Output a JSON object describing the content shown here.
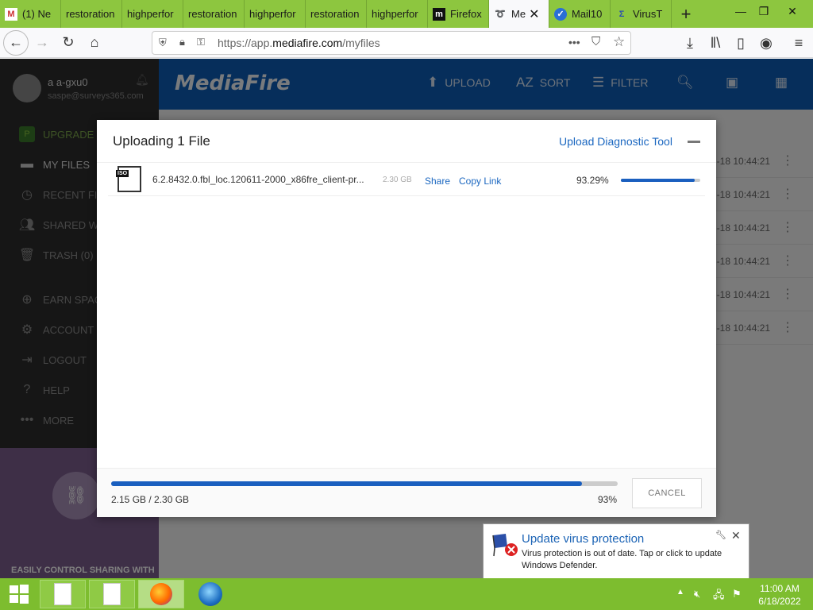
{
  "browser": {
    "tabs": [
      {
        "label": "(1) Ne",
        "icon": "mail-icon"
      },
      {
        "label": "restoration",
        "icon": ""
      },
      {
        "label": "highperfor",
        "icon": ""
      },
      {
        "label": "restoration",
        "icon": ""
      },
      {
        "label": "highperfor",
        "icon": ""
      },
      {
        "label": "restoration",
        "icon": ""
      },
      {
        "label": "highperfor",
        "icon": ""
      },
      {
        "label": "Firefox",
        "icon": "m-logo-icon"
      },
      {
        "label": "Me",
        "icon": "mediafire-icon",
        "active": true
      },
      {
        "label": "Mail10",
        "icon": "mail-icon"
      },
      {
        "label": "VirusT",
        "icon": "virustotal-icon"
      }
    ],
    "url_prefix": "https://app.",
    "url_domain": "mediafire.com",
    "url_path": "/myfiles"
  },
  "sidebar": {
    "user_name": "a a-gxu0",
    "user_email": "saspe@surveys365.com",
    "items": [
      {
        "label": "UPGRADE T",
        "icon": "upgrade-icon"
      },
      {
        "label": "MY FILES",
        "icon": "folder-icon"
      },
      {
        "label": "RECENT FI",
        "icon": "clock-icon"
      },
      {
        "label": "SHARED WI",
        "icon": "people-icon"
      },
      {
        "label": "TRASH (0)",
        "icon": "trash-icon"
      },
      {
        "label": "EARN SPAC",
        "icon": "plus-circle-icon"
      },
      {
        "label": "ACCOUNT",
        "icon": "gear-icon"
      },
      {
        "label": "LOGOUT",
        "icon": "logout-icon"
      },
      {
        "label": "HELP",
        "icon": "help-icon"
      },
      {
        "label": "MORE",
        "icon": "more-icon"
      }
    ],
    "promo_text": "EASILY CONTROL SHARING WITH"
  },
  "header": {
    "logo": "MediaFire",
    "upload": "UPLOAD",
    "sort": "SORT",
    "filter": "FILTER"
  },
  "files": {
    "dates": [
      "6-18 10:44:21",
      "6-18 10:44:21",
      "6-18 10:44:21",
      "6-18 10:44:21",
      "6-18 10:44:21",
      "6-18 10:44:21"
    ]
  },
  "dialog": {
    "title": "Uploading 1 File",
    "diagnostic_link": "Upload Diagnostic Tool",
    "file": {
      "badge": "ISO",
      "name": "6.2.8432.0.fbl_loc.120611-2000_x86fre_client-pr...",
      "size": "2.30 GB",
      "share": "Share",
      "copy_link": "Copy Link",
      "percent_text": "93.29%",
      "progress": 0.9329
    },
    "total_text": "2.15 GB / 2.30 GB",
    "total_percent_text": "93%",
    "total_progress": 0.93,
    "cancel": "CANCEL"
  },
  "toast": {
    "title": "Update virus protection",
    "body": "Virus protection is out of date. Tap or click to update Windows Defender."
  },
  "taskbar": {
    "time": "11:00 AM",
    "date": "6/18/2022"
  },
  "colors": {
    "tabbar": "#8dc63f",
    "mediafire_blue": "#0c5db7",
    "progress": "#1a5fbf",
    "taskbar": "#7dbd2f"
  }
}
